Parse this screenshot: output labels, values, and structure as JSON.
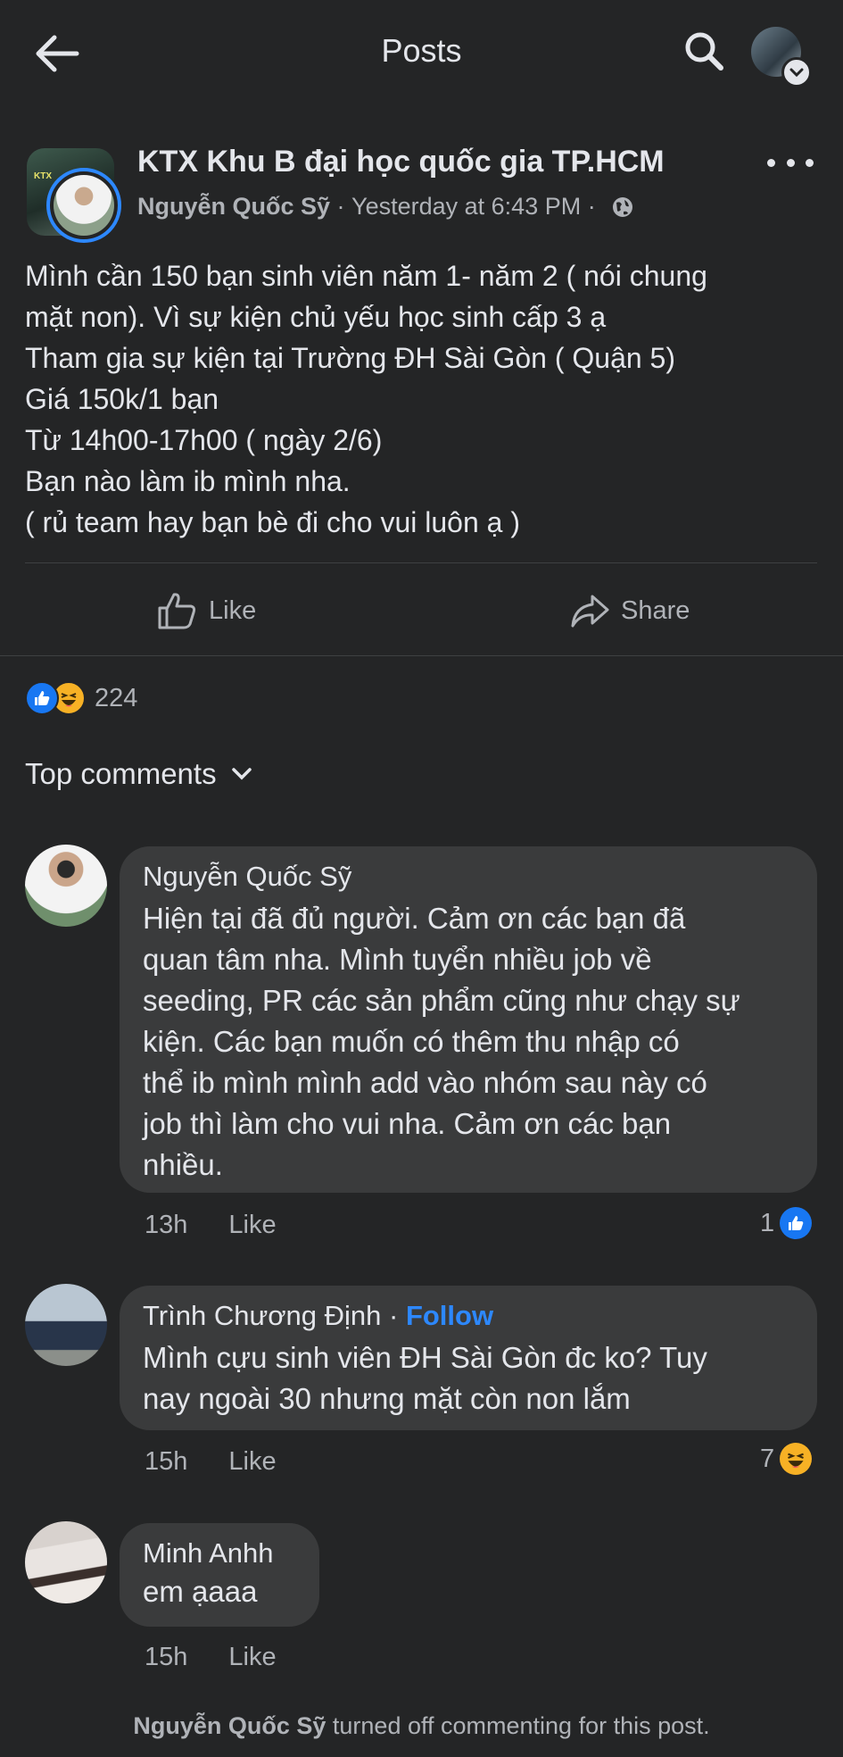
{
  "header": {
    "title": "Posts",
    "back_icon": "arrow-left-icon",
    "search_icon": "search-icon",
    "profile_icon": "avatar-with-chevron"
  },
  "post": {
    "group_name": "KTX Khu B đại học quốc gia TP.HCM",
    "author": "Nguyễn Quốc Sỹ",
    "separator": " · ",
    "time": "Yesterday at 6:43 PM",
    "audience_icon": "globe-icon",
    "body_lines": [
      "Mình cần 150 bạn sinh viên năm 1- năm 2 ( nói chung",
      "mặt non). Vì sự kiện chủ yếu học sinh cấp 3 ạ",
      "Tham gia sự kiện tại Trường ĐH Sài Gòn ( Quận 5)",
      "Giá 150k/1 bạn",
      "Từ 14h00-17h00 ( ngày 2/6)",
      "Bạn nào làm ib mình nha.",
      "( rủ team hay bạn bè đi cho vui luôn ạ )"
    ],
    "actions": {
      "like": "Like",
      "share": "Share"
    },
    "reactions_count": "224"
  },
  "comments_section": {
    "title": "Top comments"
  },
  "comments": [
    {
      "name": "Nguyễn Quốc Sỹ",
      "follow": "",
      "lines": [
        "Hiện tại đã đủ người. Cảm ơn các bạn đã",
        "quan tâm nha. Mình tuyển nhiều job về",
        "seeding, PR các sản phẩm cũng như chạy sự",
        "kiện. Các bạn muốn có thêm thu nhập có",
        "thể ib mình mình add vào nhóm sau này có",
        "job thì làm cho vui nha. Cảm ơn các bạn",
        "nhiều."
      ],
      "time": "13h",
      "like": "Like",
      "reaction_count": "1"
    },
    {
      "name": "Trình Chương Định",
      "separator": " · ",
      "follow": "Follow",
      "lines": [
        "Mình cựu sinh viên ĐH Sài Gòn đc ko? Tuy",
        "nay ngoài 30 nhưng mặt còn non lắm"
      ],
      "time": "15h",
      "like": "Like",
      "reaction_count": "7"
    },
    {
      "name": "Minh Anhh",
      "follow": "",
      "lines": [
        "em ạaaa"
      ],
      "time": "15h",
      "like": "Like",
      "reaction_count": ""
    }
  ],
  "footer": {
    "name": "Nguyễn Quốc Sỹ",
    "text": " turned off commenting for this post."
  },
  "colors": {
    "background": "#242526",
    "bubble": "#3a3b3c",
    "accent": "#2d88ff",
    "text_primary": "#e4e6eb",
    "text_secondary": "#b0b3b8"
  }
}
